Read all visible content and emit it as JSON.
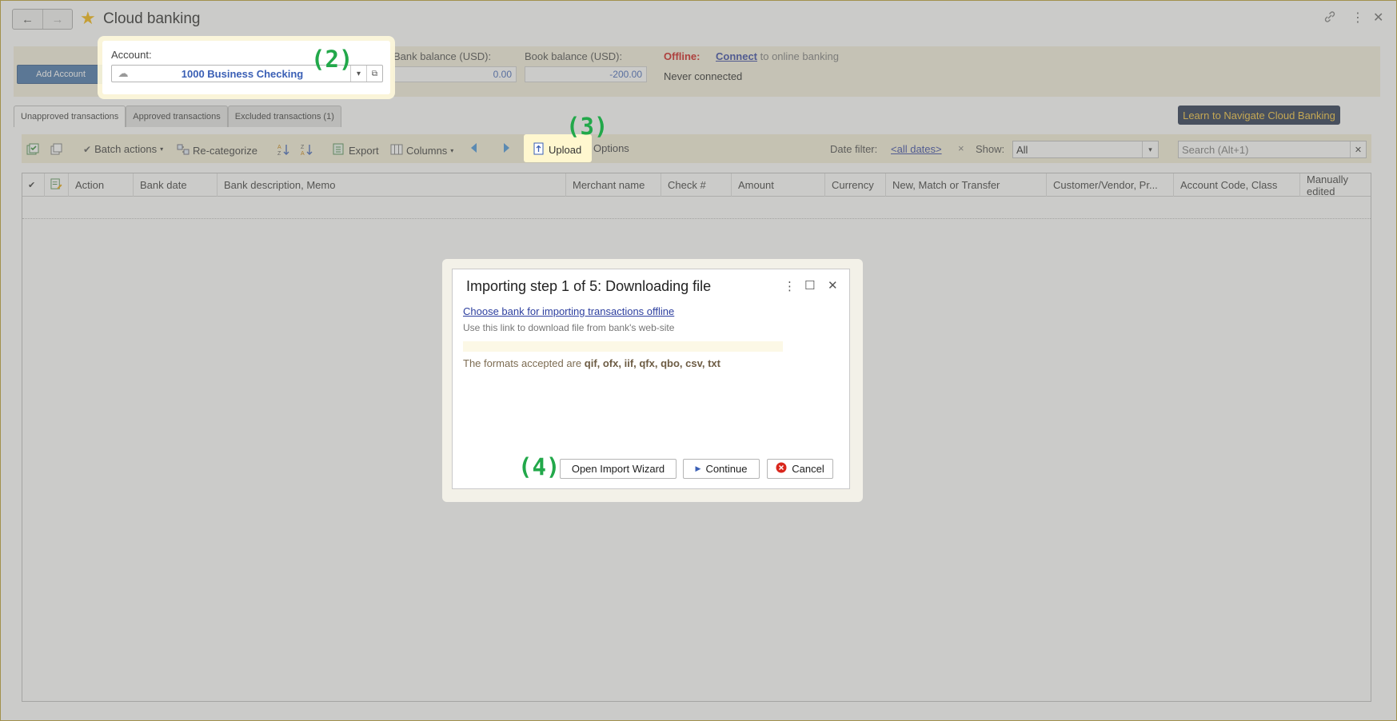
{
  "window": {
    "title": "Cloud banking",
    "back_glyph": "←",
    "forward_glyph": "→"
  },
  "header": {
    "add_account_label": "Add Account",
    "account_label": "Account:",
    "account_value": "1000 Business Checking",
    "bank_balance_label": "Bank balance (USD):",
    "bank_balance_value": "0.00",
    "book_balance_label": "Book balance (USD):",
    "book_balance_value": "-200.00",
    "offline_label": "Offline:",
    "connect_link": "Connect",
    "connect_suffix": "to online banking",
    "connection_status": "Never connected"
  },
  "callouts": {
    "account": "(2)",
    "upload": "(3)",
    "dialog_buttons": "(4)"
  },
  "tabs": [
    {
      "label": "Unapproved transactions",
      "active": true
    },
    {
      "label": "Approved transactions",
      "active": false
    },
    {
      "label": "Excluded transactions (1)",
      "active": false
    }
  ],
  "learn_button": "Learn to Navigate Cloud Banking",
  "toolbar": {
    "batch_actions": "Batch actions",
    "recategorize": "Re-categorize",
    "export": "Export",
    "columns": "Columns",
    "upload": "Upload",
    "options": "Options",
    "date_filter_label": "Date filter:",
    "date_filter_value": "<all dates>",
    "show_label": "Show:",
    "show_value": "All",
    "search_placeholder": "Search (Alt+1)"
  },
  "table": {
    "columns": [
      "Action",
      "Bank date",
      "Bank description, Memo",
      "Merchant name",
      "Check #",
      "Amount",
      "Currency",
      "New, Match or Transfer",
      "Customer/Vendor, Pr...",
      "Account Code, Class",
      "Manually edited"
    ]
  },
  "dialog": {
    "title": "Importing step 1 of 5: Downloading file",
    "bank_link": "Choose bank for importing transactions offline",
    "hint": "Use this link to download file from bank's web-site",
    "formats_prefix": "The formats accepted are",
    "formats_list": "qif, ofx, iif, qfx, qbo, csv, txt",
    "open_wizard": "Open Import Wizard",
    "continue": "Continue",
    "cancel": "Cancel"
  },
  "colors": {
    "accent_yellow": "#f4efd7",
    "callout_green": "#22a84a",
    "link_blue": "#2d3f9f",
    "learn_bg": "#1e2c48",
    "learn_text": "#f3c236"
  }
}
